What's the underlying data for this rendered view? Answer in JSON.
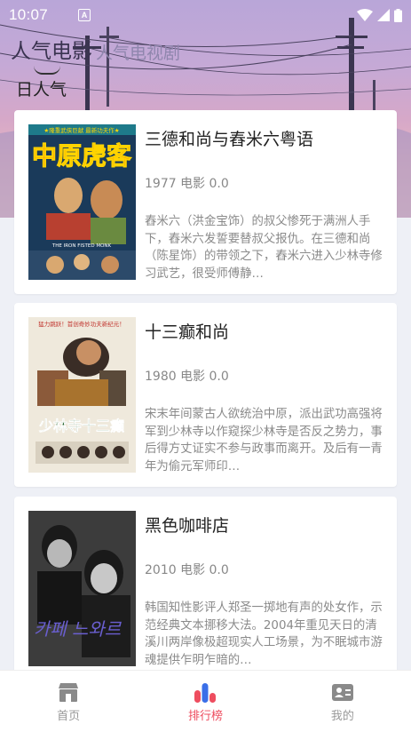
{
  "status_bar": {
    "time": "10:07",
    "notification": "A"
  },
  "header": {
    "tabs": [
      {
        "label": "人气电影",
        "active": true
      },
      {
        "label": "人气电视剧",
        "active": false
      }
    ],
    "subtitle": "日人气"
  },
  "movies": [
    {
      "title": "三德和尚与舂米六粤语",
      "meta": "1977 电影 0.0",
      "description": "舂米六（洪金宝饰）的叔父惨死于满洲人手下，舂米六发誓要替叔父报仇。在三德和尚（陈星饰）的带领之下，舂米六进入少林寺修习武艺，很受师傅静…",
      "poster_text": "中原虎客",
      "poster_top_text": "★隆重武侠巨献 最新功夫作★",
      "poster_en": "THE IRON FISTED MONK"
    },
    {
      "title": "十三癫和尚",
      "meta": "1980 电影 0.0",
      "description": "宋末年间蒙古人欲统治中原，派出武功高强将军到少林寺以作窥探少林寺是否反之势力，事后得方丈证实不参与政事而离开。及后有一青年为偷元军师印…",
      "poster_text": "少林寺十三癫",
      "poster_top_text": "猛力跳跃！首创奇妙功夫新纪元！"
    },
    {
      "title": "黑色咖啡店",
      "meta": "2010 电影 0.0",
      "description": "韩国知性影评人郑圣一掷地有声的处女作，示范经典文本挪移大法。2004年重见天日的清溪川两岸像极超现实人工场景，为不眠城市游魂提供乍明乍暗的…",
      "poster_text": "카페 느와르"
    }
  ],
  "bottom_nav": [
    {
      "label": "首页",
      "icon": "home-icon",
      "active": false
    },
    {
      "label": "排行榜",
      "icon": "ranking-icon",
      "active": true
    },
    {
      "label": "我的",
      "icon": "profile-card-icon",
      "active": false
    }
  ],
  "colors": {
    "accent": "#ee4d5f",
    "nav_inactive": "#999999",
    "hero_top": "#b9a6d8",
    "hero_bottom": "#eec3c6"
  }
}
